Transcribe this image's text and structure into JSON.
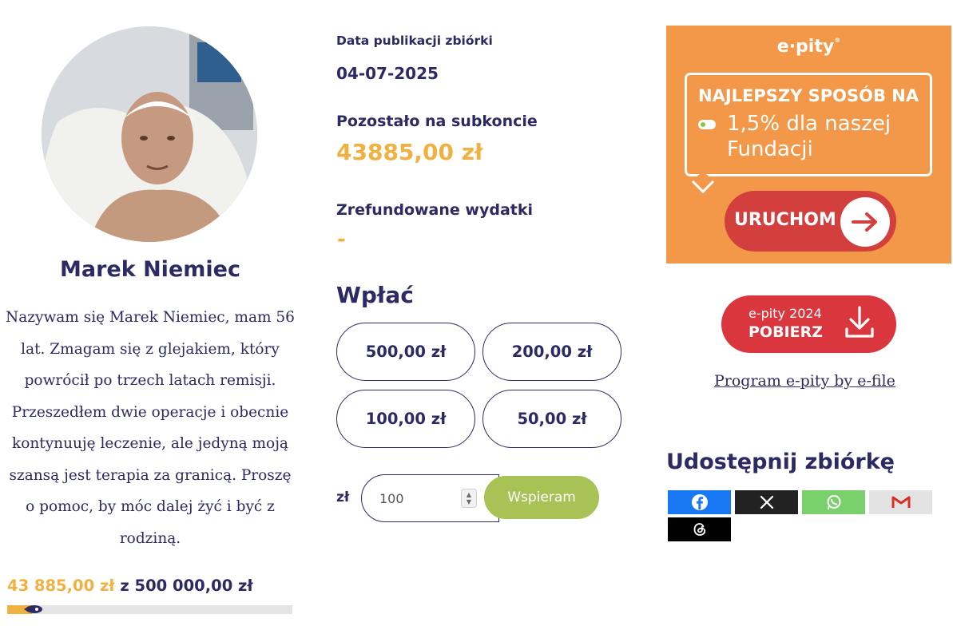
{
  "profile": {
    "name": "Marek Niemiec",
    "description": "Nazywam się Marek Niemiec, mam 56 lat. Zmagam się z glejakiem, który powrócił po trzech latach remisji. Przeszedłem dwie operacje i obecnie kontynuuję leczenie, ale jedyną moją szansą jest terapia za granicą. Proszę o pomoc, by móc dalej żyć i być z rodziną.",
    "avatar_icon": "patient-photo"
  },
  "progress": {
    "raised": "43 885,00 zł",
    "of": "z",
    "goal": "500 000,00 zł",
    "fraction": 0.088,
    "bar_color": "#f0b141",
    "icon": "rocket-icon"
  },
  "fundraiser": {
    "publication_label": "Data publikacji zbiórki",
    "publication_date": "04-07-2025",
    "remaining_label": "Pozostało na subkoncie",
    "remaining_value": "43885,00 zł",
    "refunded_label": "Zrefundowane wydatki",
    "refunded_value": "-"
  },
  "donate": {
    "title": "Wpłać",
    "amounts": [
      "500,00 zł",
      "200,00 zł",
      "100,00 zł",
      "50,00 zł"
    ],
    "currency": "zł",
    "input_value": "100",
    "submit_label": "Wspieram",
    "submit_color": "#a8c256"
  },
  "banner": {
    "logo": "e·pity",
    "headline": "NAJLEPSZY SPOSÓB NA",
    "text": "1,5% dla naszej Fundacji",
    "button": "URUCHOM",
    "background": "#f29848",
    "button_color": "#d33f3d"
  },
  "download": {
    "line1": "e-pity 2024",
    "line2": "POBIERZ",
    "color": "#d9363e"
  },
  "program_link": "Program e-pity by e-file",
  "share": {
    "title": "Udostępnij zbiórkę",
    "buttons": [
      {
        "name": "facebook",
        "icon": "facebook-icon",
        "color": "#1877f2"
      },
      {
        "name": "x",
        "icon": "x-icon",
        "color": "#222222"
      },
      {
        "name": "whatsapp",
        "icon": "whatsapp-icon",
        "color": "#7ad06d"
      },
      {
        "name": "gmail",
        "icon": "gmail-icon",
        "color": "#e3e3e3"
      },
      {
        "name": "threads",
        "icon": "threads-icon",
        "color": "#000000"
      }
    ]
  },
  "colors": {
    "primary_text": "#2b2a63",
    "accent": "#f0b141"
  }
}
